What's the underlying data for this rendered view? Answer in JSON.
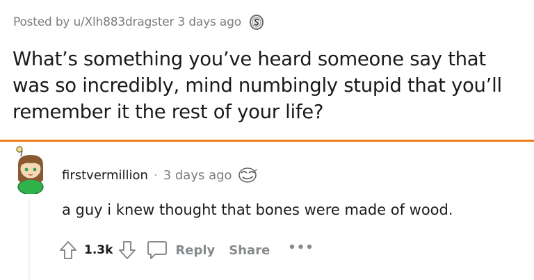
{
  "post": {
    "meta": "Posted by u/Xlh883dragster 3 days ago",
    "award_icon": "silver-award-icon",
    "title": "What’s something you’ve heard someone say that was so incredibly, mind numbingly stupid that you’ll remember it the rest of your life?"
  },
  "comment": {
    "username": "firstvermillion",
    "separator": "·",
    "time": "3 days ago",
    "award_icon": "face-award-icon",
    "body": "a guy i knew thought that bones were made of wood.",
    "score": "1.3k",
    "actions": {
      "reply": "Reply",
      "share": "Share",
      "more": "•••"
    }
  },
  "colors": {
    "divider": "#f07b1a",
    "text": "#1a1a1b",
    "meta": "#7c7c7c",
    "action": "#878a8c"
  }
}
